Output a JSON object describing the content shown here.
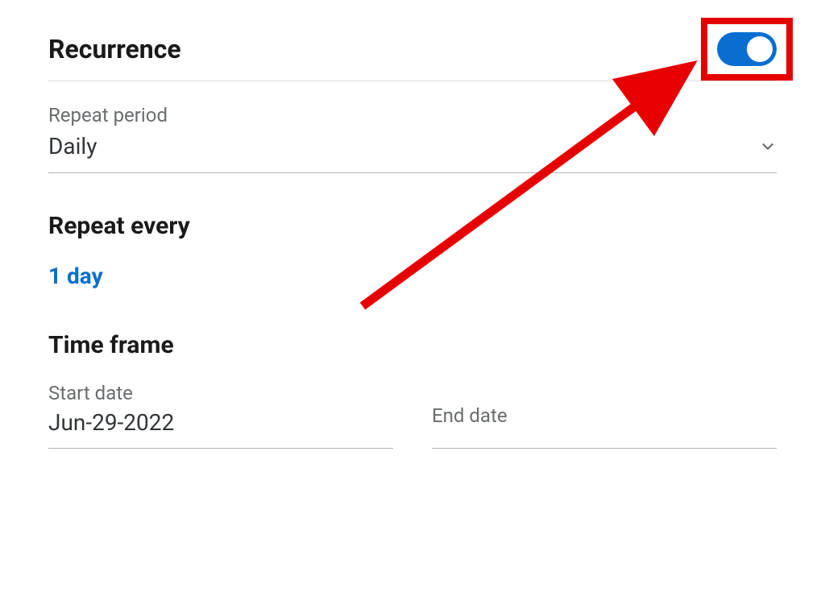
{
  "recurrence": {
    "title": "Recurrence",
    "toggle_on": true
  },
  "repeat_period": {
    "label": "Repeat period",
    "value": "Daily"
  },
  "repeat_every": {
    "title": "Repeat every",
    "value": "1 day"
  },
  "time_frame": {
    "title": "Time frame",
    "start_date": {
      "label": "Start date",
      "value": "Jun-29-2022"
    },
    "end_date": {
      "label": "End date",
      "value": ""
    }
  },
  "colors": {
    "accent": "#0a6ed1",
    "annotation": "#e60000"
  }
}
